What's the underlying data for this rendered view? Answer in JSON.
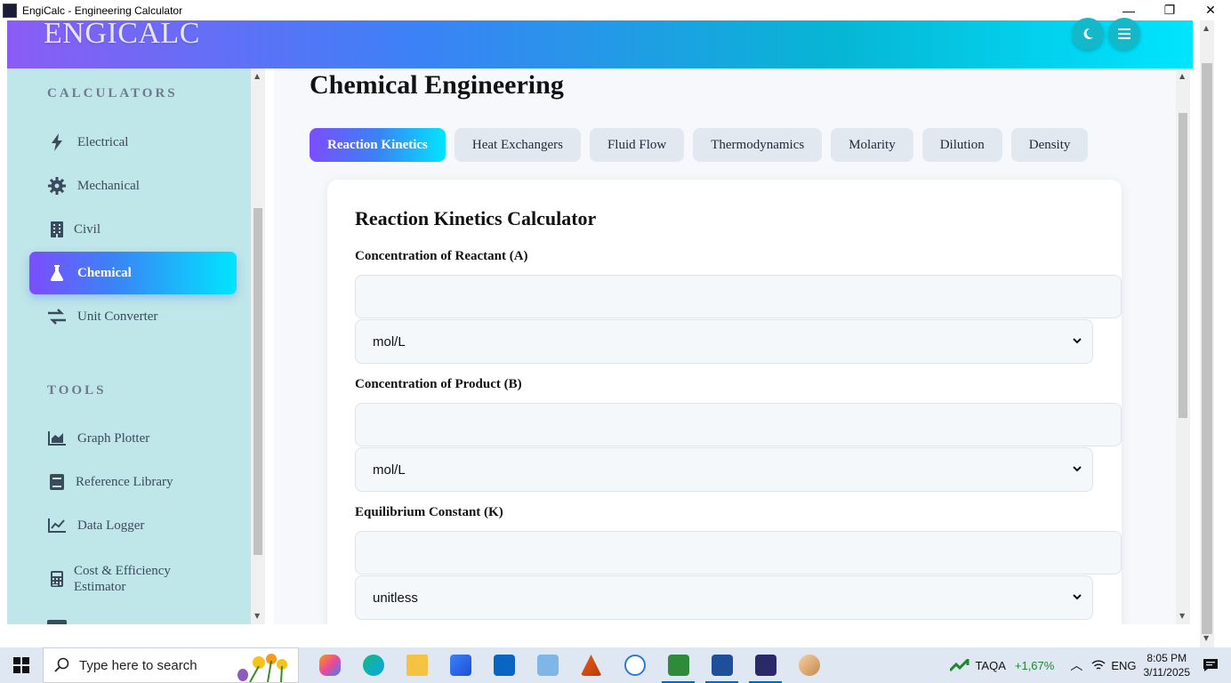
{
  "window": {
    "title": "EngiCalc - Engineering Calculator",
    "controls": {
      "minimize": "—",
      "maximize": "❐",
      "close": "✕"
    }
  },
  "header": {
    "logo": "ENGICALC",
    "buttons": [
      {
        "name": "dark-mode-toggle",
        "icon": "moon-icon"
      },
      {
        "name": "menu-button",
        "icon": "hamburger-icon"
      }
    ]
  },
  "sidebar": {
    "calculators_heading": "CALCULATORS",
    "calculators": [
      {
        "label": "Electrical",
        "icon": "bolt-icon"
      },
      {
        "label": "Mechanical",
        "icon": "gear-icon"
      },
      {
        "label": "Civil",
        "icon": "building-icon"
      },
      {
        "label": "Chemical",
        "icon": "flask-icon",
        "active": true
      },
      {
        "label": "Unit Converter",
        "icon": "exchange-icon"
      }
    ],
    "tools_heading": "TOOLS",
    "tools": [
      {
        "label": "Graph Plotter",
        "icon": "area-chart-icon"
      },
      {
        "label": "Reference Library",
        "icon": "book-icon"
      },
      {
        "label": "Data Logger",
        "icon": "line-chart-icon"
      },
      {
        "label_line1": "Cost & Efficiency",
        "label_line2": "Estimator",
        "icon": "calculator-icon"
      }
    ]
  },
  "main": {
    "page_title": "Chemical Engineering",
    "tabs": [
      {
        "label": "Reaction Kinetics",
        "active": true
      },
      {
        "label": "Heat Exchangers"
      },
      {
        "label": "Fluid Flow"
      },
      {
        "label": "Thermodynamics"
      },
      {
        "label": "Molarity"
      },
      {
        "label": "Dilution"
      },
      {
        "label": "Density"
      }
    ],
    "card": {
      "title": "Reaction Kinetics Calculator",
      "fields": [
        {
          "label": "Concentration of Reactant (A)",
          "value": "",
          "unit": "mol/L"
        },
        {
          "label": "Concentration of Product (B)",
          "value": "",
          "unit": "mol/L"
        },
        {
          "label": "Equilibrium Constant (K)",
          "value": "",
          "unit": "unitless"
        }
      ]
    }
  },
  "taskbar": {
    "search_placeholder": "Type here to search",
    "stock_name": "TAQA",
    "stock_change": "+1,67%",
    "language": "ENG",
    "time": "8:05 PM",
    "date": "3/11/2025"
  },
  "colors": {
    "accent_purple": "#7c4dff",
    "accent_blue": "#3b82f6",
    "accent_cyan": "#00e5ff",
    "sidebar_bg": "#bfe6e8",
    "stock_up": "#1a8a2a"
  }
}
